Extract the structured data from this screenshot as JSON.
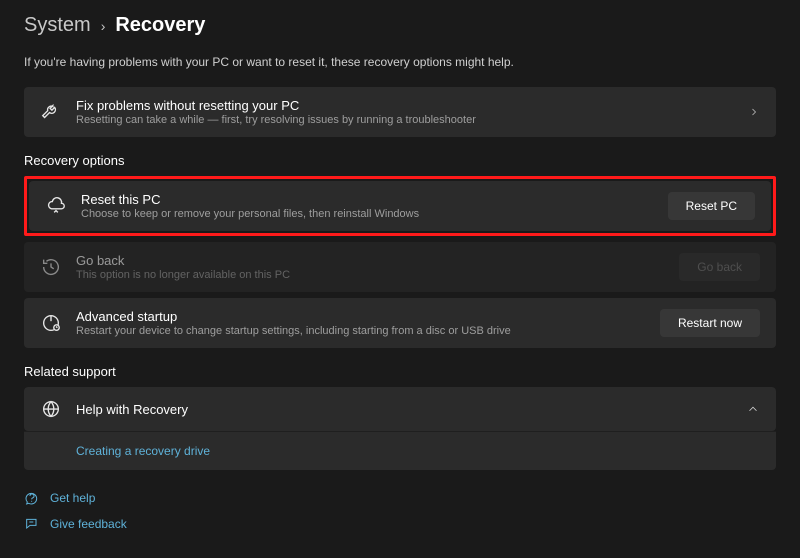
{
  "breadcrumb": {
    "parent": "System",
    "current": "Recovery"
  },
  "intro": "If you're having problems with your PC or want to reset it, these recovery options might help.",
  "fixProblems": {
    "title": "Fix problems without resetting your PC",
    "sub": "Resetting can take a while — first, try resolving issues by running a troubleshooter"
  },
  "sections": {
    "recoveryOptions": "Recovery options",
    "relatedSupport": "Related support"
  },
  "resetPC": {
    "title": "Reset this PC",
    "sub": "Choose to keep or remove your personal files, then reinstall Windows",
    "button": "Reset PC"
  },
  "goBack": {
    "title": "Go back",
    "sub": "This option is no longer available on this PC",
    "button": "Go back"
  },
  "advancedStartup": {
    "title": "Advanced startup",
    "sub": "Restart your device to change startup settings, including starting from a disc or USB drive",
    "button": "Restart now"
  },
  "helpRecovery": {
    "title": "Help with Recovery",
    "link": "Creating a recovery drive"
  },
  "footer": {
    "getHelp": "Get help",
    "giveFeedback": "Give feedback"
  }
}
